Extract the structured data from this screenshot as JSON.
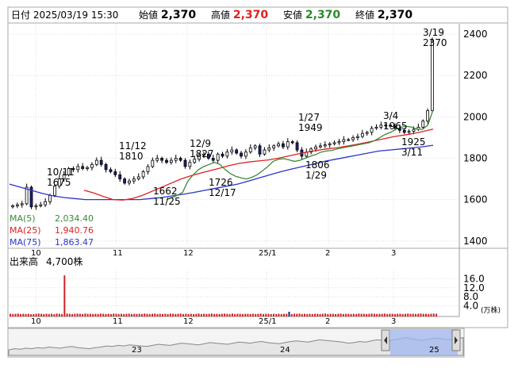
{
  "header": {
    "date_label": "日付",
    "date_value": "2025/03/19 15:30",
    "open_label": "始値",
    "open_value": "2,370",
    "high_label": "高値",
    "high_value": "2,370",
    "low_label": "安値",
    "low_value": "2,370",
    "close_label": "終値",
    "close_value": "2,370"
  },
  "colors": {
    "up": "#ffffff",
    "down": "#1a237e",
    "ma5": "#3a8a3a",
    "ma25": "#e02020",
    "ma75": "#2a36c8",
    "volume": "#d42020",
    "high_text": "#e02020",
    "low_text": "#2a8a2a",
    "navigator_fill": "#9fb6ee"
  },
  "chart_data": [
    {
      "type": "candlestick",
      "y_ticks": [
        1400,
        1600,
        1800,
        2000,
        2200,
        2400
      ],
      "ylim": [
        1380,
        2450
      ],
      "x_ticks": [
        "10",
        "11",
        "12",
        "25/1",
        "2",
        "3"
      ],
      "legend": [
        {
          "name": "MA(5)",
          "value": "2,034.40"
        },
        {
          "name": "MA(25)",
          "value": "1,940.76"
        },
        {
          "name": "MA(75)",
          "value": "1,863.47"
        }
      ],
      "annotations": [
        {
          "date": "10/11",
          "price": "1675"
        },
        {
          "date": "11/12",
          "price": "1810"
        },
        {
          "date": "11/25",
          "price": "1662"
        },
        {
          "date": "12/9",
          "price": "1827"
        },
        {
          "date": "12/17",
          "price": "1726"
        },
        {
          "date": "1/27",
          "price": "1949"
        },
        {
          "date": "1/29",
          "price": "1806"
        },
        {
          "date": "3/4",
          "price": "1965"
        },
        {
          "date": "3/11",
          "price": "1925"
        },
        {
          "date": "3/19",
          "price": "2370"
        }
      ],
      "series": [
        {
          "name": "close",
          "values": [
            1570,
            1575,
            1580,
            1660,
            1565,
            1570,
            1575,
            1590,
            1620,
            1665,
            1700,
            1720,
            1750,
            1745,
            1760,
            1750,
            1755,
            1770,
            1790,
            1770,
            1745,
            1735,
            1720,
            1700,
            1680,
            1690,
            1700,
            1710,
            1735,
            1760,
            1790,
            1800,
            1790,
            1780,
            1790,
            1800,
            1790,
            1760,
            1780,
            1795,
            1815,
            1820,
            1800,
            1790,
            1820,
            1810,
            1830,
            1840,
            1825,
            1810,
            1830,
            1850,
            1860,
            1820,
            1840,
            1850,
            1860,
            1870,
            1855,
            1880,
            1875,
            1840,
            1810,
            1830,
            1845,
            1855,
            1860,
            1865,
            1870,
            1875,
            1880,
            1890,
            1890,
            1900,
            1905,
            1920,
            1925,
            1945,
            1950,
            1960,
            1960,
            1955,
            1945,
            1935,
            1925,
            1930,
            1940,
            1950,
            1980,
            2030,
            2370
          ]
        },
        {
          "name": "MA(5)",
          "values": [
            1600,
            1610,
            1620,
            1635,
            1690,
            1720,
            1745,
            1760,
            1770,
            1780,
            1770,
            1745,
            1725,
            1712,
            1705,
            1700,
            1708,
            1720,
            1740,
            1760,
            1785,
            1795,
            1798,
            1792,
            1785,
            1790,
            1800,
            1810,
            1818,
            1830,
            1835,
            1838,
            1845,
            1850,
            1855,
            1860,
            1865,
            1870,
            1875,
            1885,
            1900,
            1915,
            1925,
            1940,
            1950,
            1955,
            1950,
            1940,
            1940,
            1960,
            2034
          ]
        },
        {
          "name": "MA(25)",
          "values": [
            1645,
            1632,
            1615,
            1600,
            1598,
            1605,
            1620,
            1640,
            1660,
            1680,
            1700,
            1715,
            1728,
            1740,
            1752,
            1765,
            1775,
            1782,
            1787,
            1792,
            1800,
            1810,
            1820,
            1830,
            1838,
            1845,
            1850,
            1858,
            1866,
            1875,
            1885,
            1895,
            1905,
            1912,
            1920,
            1930,
            1941
          ]
        },
        {
          "name": "MA(75)",
          "values": [
            1675,
            1660,
            1645,
            1630,
            1618,
            1610,
            1605,
            1600,
            1600,
            1600,
            1600,
            1600,
            1600,
            1605,
            1610,
            1618,
            1626,
            1635,
            1645,
            1655,
            1665,
            1675,
            1690,
            1705,
            1720,
            1735,
            1748,
            1760,
            1772,
            1785,
            1795,
            1805,
            1815,
            1825,
            1835,
            1840,
            1845,
            1850,
            1855,
            1863
          ]
        }
      ]
    },
    {
      "type": "bar",
      "title": "出来高",
      "latest_value": "4,700株",
      "unit": "(万株)",
      "y_ticks": [
        "16.0",
        "12.0",
        "8.0",
        "4.0"
      ],
      "ylim": [
        0,
        20
      ],
      "x_ticks": [
        "10",
        "11",
        "12",
        "25/1",
        "2",
        "3"
      ],
      "values": [
        0.5,
        0.4,
        0.5,
        0.6,
        0.4,
        0.5,
        0.4,
        0.5,
        0.3,
        0.4,
        0.5,
        0.6,
        0.5,
        0.4,
        0.5,
        0.4,
        0.5,
        0.3,
        0.6,
        0.5,
        0.4,
        17.5,
        0.6,
        0.5,
        0.4,
        0.5,
        0.6,
        0.5,
        0.4,
        0.6,
        0.5,
        0.5,
        0.4,
        0.5,
        0.4,
        0.6,
        0.5,
        0.4,
        0.5,
        0.4,
        0.6,
        0.5,
        0.4,
        0.5,
        0.4,
        0.5,
        0.6,
        0.4,
        0.5,
        0.4,
        0.5,
        0.4,
        0.6,
        0.5,
        0.4,
        0.5,
        0.6,
        0.4,
        0.5,
        0.4,
        0.5,
        0.4,
        0.6,
        0.5,
        0.4,
        0.5,
        0.6,
        0.4,
        0.5,
        0.4,
        0.5,
        0.4,
        0.5,
        0.6,
        0.4,
        0.5,
        0.4,
        0.5,
        0.6,
        0.4,
        0.5,
        0.4,
        0.5,
        0.6,
        0.5,
        0.4,
        0.6,
        0.4,
        0.5,
        0.5,
        0.4,
        0.5,
        0.5,
        0.4,
        0.5,
        0.4,
        0.5,
        0.6,
        0.4,
        0.5,
        0.5,
        0.4,
        0.5,
        0.4,
        0.5,
        0.4,
        0.5,
        0.5,
        1.4,
        0.4,
        0.5,
        0.5,
        0.6,
        0.4,
        0.5,
        0.4,
        0.5,
        0.4,
        0.5,
        0.5,
        0.4,
        0.5,
        0.6,
        0.4,
        0.5,
        0.5,
        0.4,
        0.5,
        0.6,
        0.4,
        0.5,
        0.5,
        0.4,
        0.5,
        0.4,
        0.6,
        0.5,
        0.5,
        0.4,
        0.5,
        0.6,
        0.5,
        0.4,
        0.5,
        0.5,
        0.6,
        0.4,
        0.5,
        0.5,
        0.4,
        0.5,
        0.5,
        0.4,
        0.5,
        0.6,
        0.5,
        0.5,
        0.4,
        0.5,
        0.6,
        0.5,
        0.5,
        0.4,
        0.5,
        0.6,
        0.5
      ]
    },
    {
      "type": "area",
      "title": "navigator",
      "x_ticks": [
        "23",
        "24",
        "25"
      ],
      "values": [
        40,
        42,
        41,
        43,
        42,
        44,
        43,
        45,
        44,
        43,
        45,
        46,
        44,
        43,
        42,
        44,
        45,
        47,
        46,
        48,
        47,
        49,
        48,
        47,
        46,
        48,
        50,
        49,
        48,
        50,
        52,
        51,
        50,
        49,
        51,
        53,
        52,
        51,
        50,
        52,
        54,
        53,
        52,
        54,
        55,
        53,
        52,
        51,
        53,
        55,
        56,
        55,
        54,
        56,
        58,
        57,
        56,
        55,
        54,
        52,
        53,
        55,
        54,
        56,
        58,
        57,
        56,
        58,
        60,
        62,
        60,
        58,
        57,
        59,
        61,
        60,
        59,
        58,
        60,
        62
      ]
    }
  ]
}
